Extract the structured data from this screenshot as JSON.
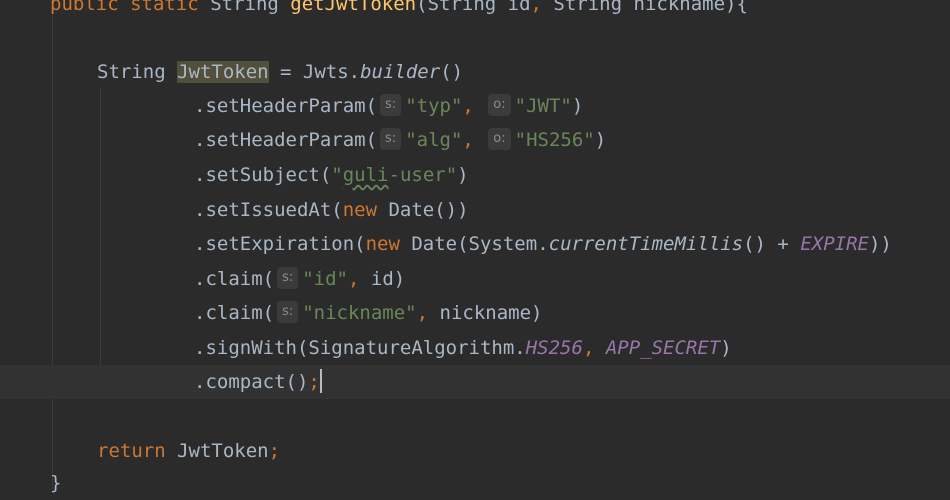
{
  "code": {
    "l0": {
      "kw1": "public",
      "kw2": "static",
      "type": "String",
      "method": "getJwtToken",
      "p1": "(String ",
      "p1name": "id",
      "comma": ",",
      "p2": " String ",
      "p2name": "nickname",
      "close": "){"
    },
    "l1": {
      "type": "String ",
      "var": "JwtToken",
      "eq": " = Jwts.",
      "call": "builder",
      "end": "()"
    },
    "l2": {
      "call": ".setHeaderParam(",
      "hint1": "s:",
      "str1": "\"typ\"",
      "comma": ",",
      "hint2": "o:",
      "str2": "\"JWT\"",
      "end": ")"
    },
    "l3": {
      "call": ".setHeaderParam(",
      "hint1": "s:",
      "str1": "\"alg\"",
      "comma": ",",
      "hint2": "o:",
      "str2": "\"HS256\"",
      "end": ")"
    },
    "l4": {
      "call": ".setSubject(",
      "q1": "\"",
      "squig": "guli",
      "rest": "-user\"",
      "end": ")"
    },
    "l5": {
      "call": ".setIssuedAt(",
      "kw": "new",
      "rest": " Date())"
    },
    "l6": {
      "call": ".setExpiration(",
      "kw": "new",
      "rest": " Date(System.",
      "method": "currentTimeMillis",
      "mid": "() + ",
      "const": "EXPIRE",
      "end": "))"
    },
    "l7": {
      "call": ".claim(",
      "hint": "s:",
      "str": "\"id\"",
      "comma": ",",
      "rest": " id)"
    },
    "l8": {
      "call": ".claim(",
      "hint": "s:",
      "str": "\"nickname\"",
      "comma": ",",
      "rest": " nickname)"
    },
    "l9": {
      "call": ".signWith(SignatureAlgorithm.",
      "const1": "HS256",
      "comma": ",",
      "const2": "APP_SECRET",
      "end": ")"
    },
    "l10": {
      "call": ".compact()",
      "semi": ";"
    },
    "l11": {
      "kw": "return",
      "rest": " JwtToken",
      "semi": ";"
    },
    "l12": {
      "brace": "}"
    }
  },
  "colors": {
    "background": "#2b2b2b",
    "keyword": "#cc7832",
    "string": "#6a8759",
    "method": "#ffc66d",
    "constant": "#9876aa",
    "text": "#a9b7c6"
  }
}
